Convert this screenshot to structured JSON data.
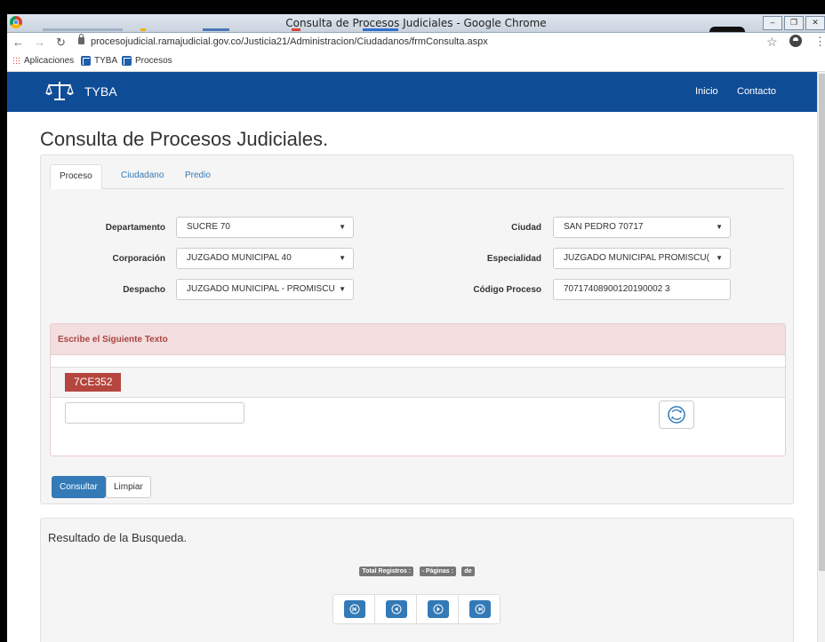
{
  "window": {
    "title": "Consulta de Procesos Judiciales - Google Chrome",
    "url": "procesojudicial.ramajudicial.gov.co/Justicia21/Administracion/Ciudadanos/frmConsulta.aspx"
  },
  "bookmarks": {
    "items": [
      "Aplicaciones",
      "TYBA",
      "Procesos"
    ]
  },
  "site": {
    "brand": "TYBA",
    "nav": [
      "Inicio",
      "Contacto"
    ],
    "accent": "#0f4c96"
  },
  "page": {
    "title": "Consulta de Procesos Judiciales.",
    "tabs": [
      "Proceso",
      "Ciudadano",
      "Predio"
    ],
    "form": {
      "departamento": {
        "label": "Departamento",
        "value": "SUCRE 70"
      },
      "ciudad": {
        "label": "Ciudad",
        "value": "SAN PEDRO 70717"
      },
      "corporacion": {
        "label": "Corporación",
        "value": "JUZGADO MUNICIPAL 40"
      },
      "especialidad": {
        "label": "Especialidad",
        "value": "JUZGADO MUNICIPAL PROMISCU("
      },
      "despacho": {
        "label": "Despacho",
        "value": "JUZGADO MUNICIPAL - PROMISCU"
      },
      "codigo": {
        "label": "Código Proceso",
        "value": "70717408900120190002 3"
      }
    },
    "captcha": {
      "heading": "Escribe el Siguiente Texto",
      "code": "7CE352",
      "input_value": ""
    },
    "buttons": {
      "consultar": "Consultar",
      "limpiar": "Limpiar"
    }
  },
  "results": {
    "title": "Resultado de la Busqueda.",
    "badges": [
      "Total Registros :",
      "- Páginas :",
      "de"
    ]
  }
}
